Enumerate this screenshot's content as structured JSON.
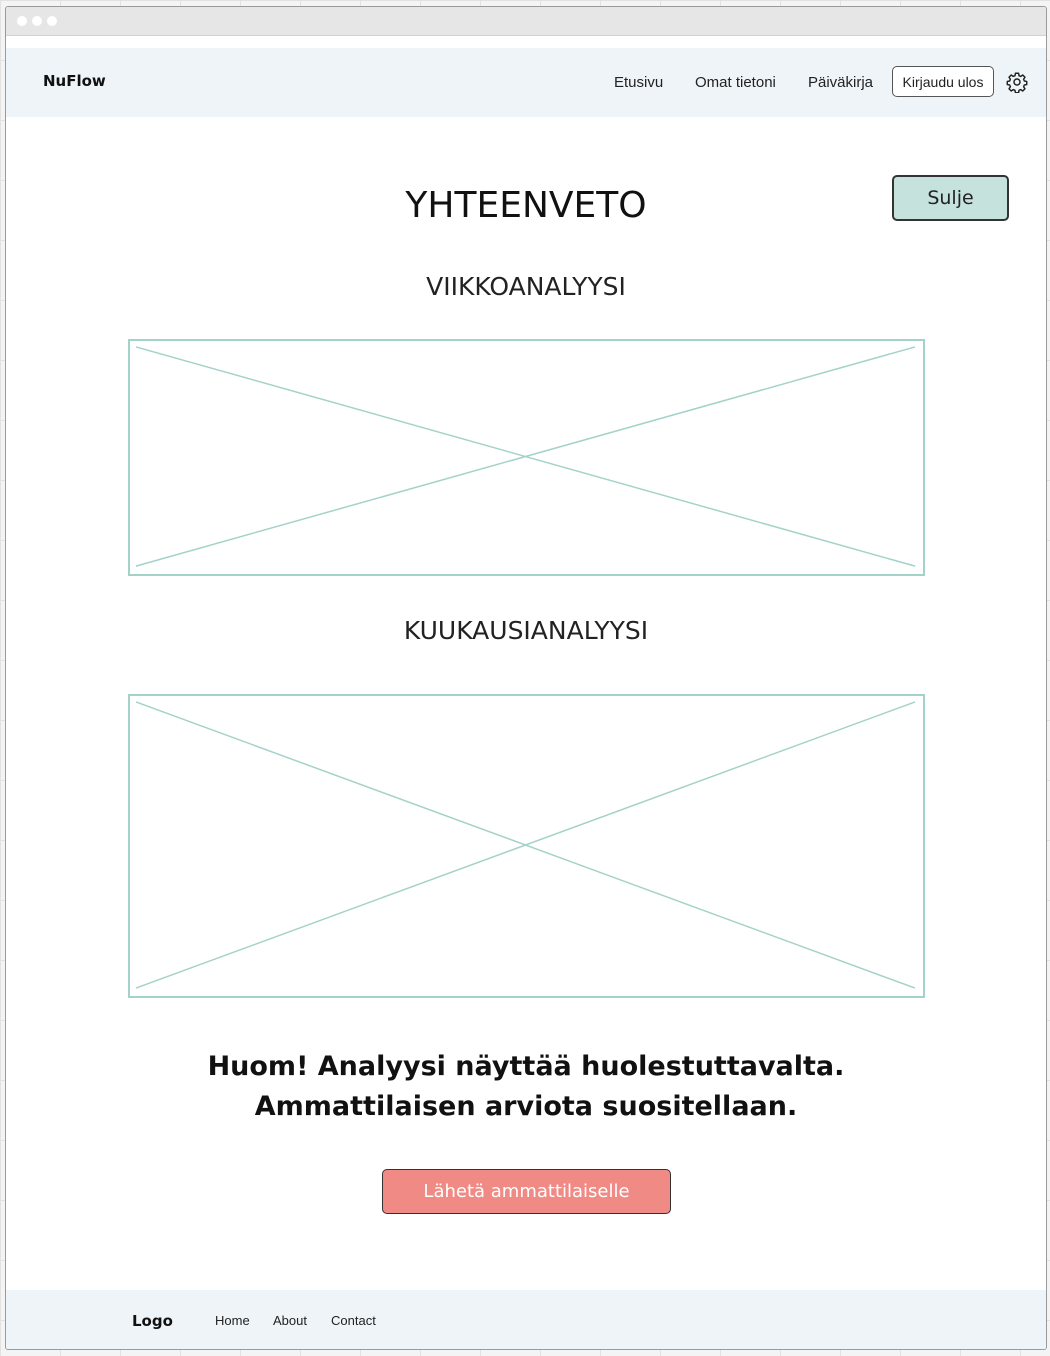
{
  "navbar": {
    "brand": "NuFlow",
    "links": [
      "Etusivu",
      "Omat tietoni",
      "Päiväkirja"
    ],
    "logout_label": "Kirjaudu ulos",
    "settings_icon": "gear-icon"
  },
  "main": {
    "close_label": "Sulje",
    "title": "YHTEENVETO",
    "weekly_title": "VIIKKOANALYYSI",
    "monthly_title": "KUUKAUSIANALYYSI",
    "warning_line1": "Huom! Analyysi näyttää huolestuttavalta.",
    "warning_line2": "Ammattilaisen arviota suositellaan.",
    "send_label": "Lähetä ammattilaiselle"
  },
  "footer": {
    "logo": "Logo",
    "links": [
      "Home",
      "About",
      "Contact"
    ]
  },
  "colors": {
    "header_bg": "#eef4f8",
    "close_button_bg": "#c6e2dc",
    "send_button_bg": "#f08a85",
    "placeholder_stroke": "#a3d2c9"
  }
}
